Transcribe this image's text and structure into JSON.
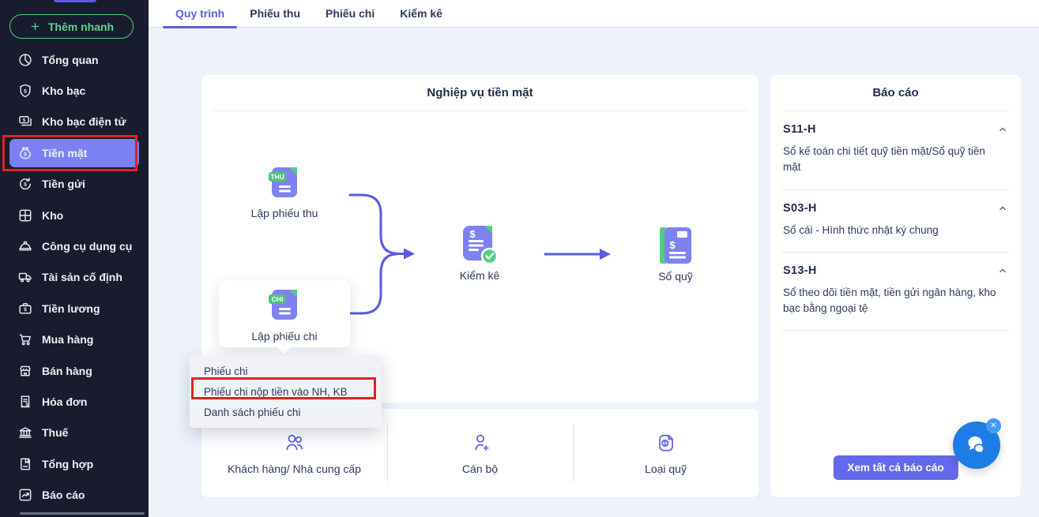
{
  "sidebar": {
    "quick_add_label": "Thêm nhanh",
    "items": [
      {
        "label": "Tổng quan",
        "icon": "pie-chart"
      },
      {
        "label": "Kho bạc",
        "icon": "shield-dollar"
      },
      {
        "label": "Kho bạc điện tử",
        "icon": "card-dollar"
      },
      {
        "label": "Tiền mặt",
        "icon": "cash-pouch",
        "active": true,
        "annotated": true
      },
      {
        "label": "Tiền gửi",
        "icon": "refresh-dollar"
      },
      {
        "label": "Kho",
        "icon": "box-grid"
      },
      {
        "label": "Công cụ dụng cụ",
        "icon": "hard-hat"
      },
      {
        "label": "Tài sản cố định",
        "icon": "truck"
      },
      {
        "label": "Tiền lương",
        "icon": "briefcase-dollar"
      },
      {
        "label": "Mua hàng",
        "icon": "cart"
      },
      {
        "label": "Bán hàng",
        "icon": "storefront"
      },
      {
        "label": "Hóa đơn",
        "icon": "receipt-dollar"
      },
      {
        "label": "Thuế",
        "icon": "bank"
      },
      {
        "label": "Tổng hợp",
        "icon": "ledger-book"
      },
      {
        "label": "Báo cáo",
        "icon": "chart-report"
      }
    ]
  },
  "tabs": [
    {
      "label": "Quy trình",
      "active": true
    },
    {
      "label": "Phiếu thu",
      "active": false
    },
    {
      "label": "Phiếu chi",
      "active": false
    },
    {
      "label": "Kiểm kê",
      "active": false
    }
  ],
  "main": {
    "title": "Nghiệp vụ tiền mặt",
    "nodes": {
      "thu": {
        "label": "Lập phiếu thu",
        "badge": "THU"
      },
      "chi": {
        "label": "Lập phiếu chi",
        "badge": "CHI"
      },
      "kiemke": {
        "label": "Kiểm kê"
      },
      "soquy": {
        "label": "Sổ quỹ"
      }
    },
    "dropdown": {
      "items": [
        {
          "label": "Phiếu chi",
          "annotated": false
        },
        {
          "label": "Phiếu chi nộp tiền vào NH, KB",
          "annotated": true
        },
        {
          "label": "Danh sách phiếu chi",
          "annotated": false
        }
      ]
    },
    "quick_links": [
      {
        "label": "Khách hàng/ Nhà cung cấp",
        "icon": "users"
      },
      {
        "label": "Cán bộ",
        "icon": "user-plus"
      },
      {
        "label": "Loại quỹ",
        "icon": "fund-doc"
      }
    ]
  },
  "reports": {
    "title": "Báo cáo",
    "items": [
      {
        "code": "S11-H",
        "description": "Sổ kế toán chi tiết quỹ tiền mặt/Sổ quỹ tiền mặt"
      },
      {
        "code": "S03-H",
        "description": "Sổ cái - Hình thức nhật ký chung"
      },
      {
        "code": "S13-H",
        "description": "Sổ theo dõi tiền mặt, tiền gửi ngân hàng, kho bạc bằng ngoại tệ"
      }
    ],
    "view_all_label": "Xem tất cả báo cáo"
  },
  "chat": {
    "close_glyph": "✕"
  },
  "colors": {
    "accent_purple": "#5a5fe0",
    "active_item_purple": "#7b80f2",
    "icon_purple_fill": "#7d82f0",
    "green": "#4ecf7f",
    "badge_green": "#4cc57d",
    "sidebar_bg": "#191c2e",
    "content_bg": "#eef2fb",
    "annotation_red": "#e32222",
    "chat_blue": "#1d7ce6",
    "button_purple": "#6468ea"
  }
}
